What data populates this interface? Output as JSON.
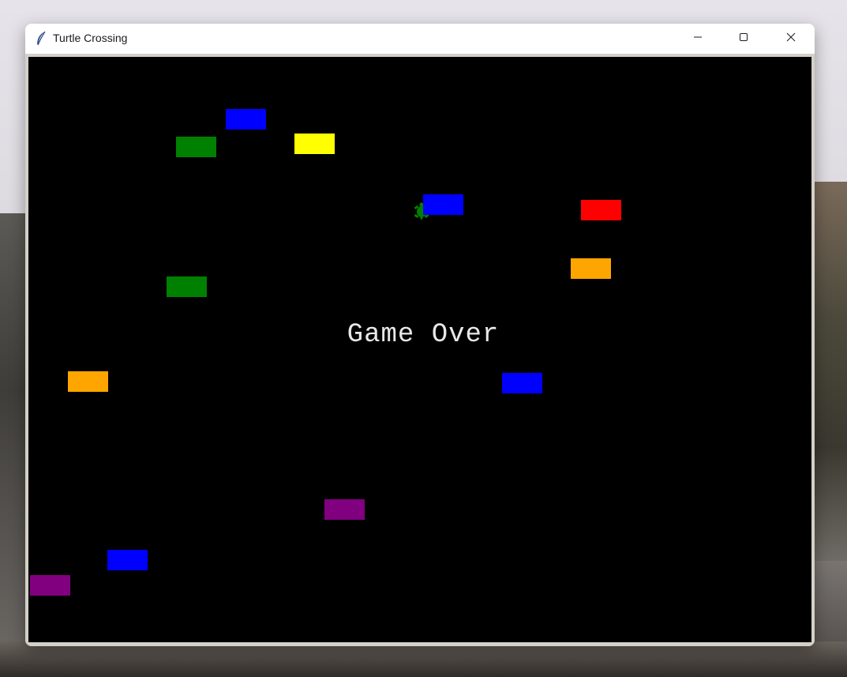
{
  "window": {
    "title": "Turtle Crossing",
    "icon": "feather-icon",
    "controls": [
      "minimize-icon",
      "maximize-icon",
      "close-icon"
    ]
  },
  "game": {
    "background": "#000000",
    "status_text": "Game Over",
    "player": {
      "shape": "turtle",
      "color": "#008000"
    },
    "cars": [
      {
        "color": "#0000ff"
      },
      {
        "color": "#008000"
      },
      {
        "color": "#ffff00"
      },
      {
        "color": "#0000ff"
      },
      {
        "color": "#ff0000"
      },
      {
        "color": "#ffa500"
      },
      {
        "color": "#008000"
      },
      {
        "color": "#ffa500"
      },
      {
        "color": "#0000ff"
      },
      {
        "color": "#800080"
      },
      {
        "color": "#0000ff"
      },
      {
        "color": "#800080"
      }
    ]
  }
}
